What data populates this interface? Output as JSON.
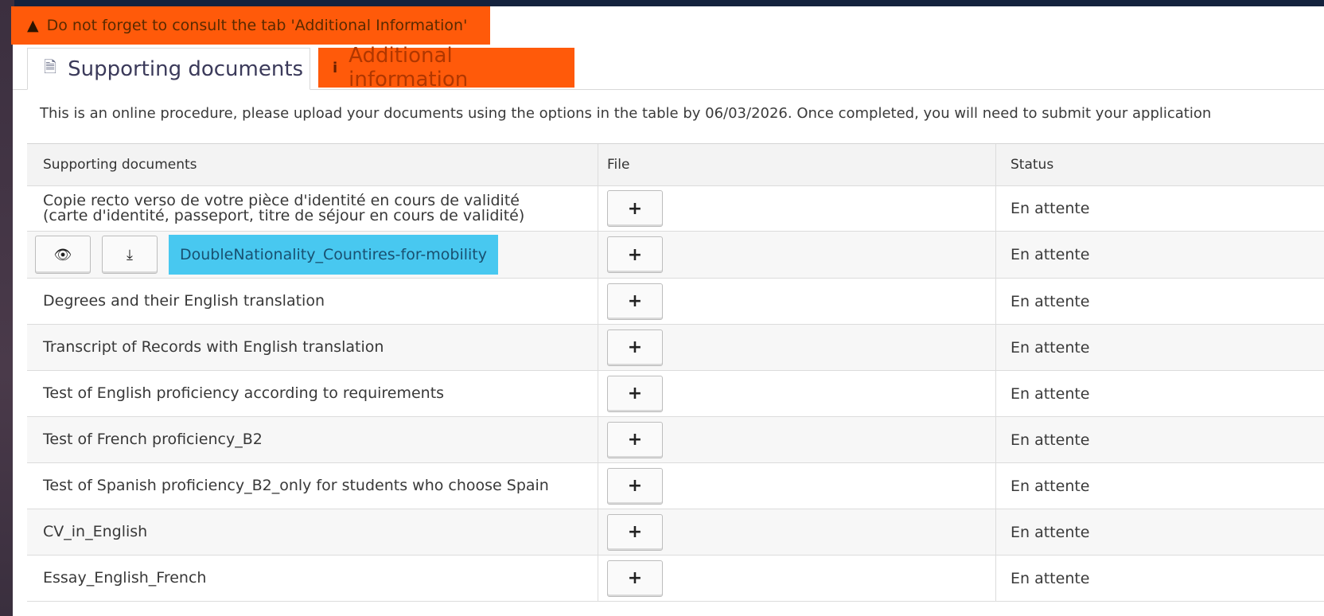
{
  "warning": {
    "icon": "warning-icon",
    "text": "Do not forget to consult the tab 'Additional Information'"
  },
  "tabs": [
    {
      "label": "Supporting documents",
      "icon": "document-icon",
      "active": true
    },
    {
      "label": "Additional information",
      "icon": "info-icon",
      "active": false
    }
  ],
  "info_text": "This is an online procedure, please upload your documents using the options in the table by 06/03/2026. Once completed, you will need to submit your application",
  "table": {
    "headers": [
      "Supporting documents",
      "File",
      "Status"
    ],
    "rows": [
      {
        "document": "Copie recto verso de votre pièce d'identité en cours de validité",
        "document_line2": "(carte d'identité, passeport, titre de séjour en cours de validité)",
        "file_button": "+",
        "status": "En attente"
      },
      {
        "file_name": "DoubleNationality_Countires-for-mobility",
        "view_icon": "eye-icon",
        "download_icon": "download-icon",
        "file_button": "+",
        "status": "En attente"
      },
      {
        "document": "Degrees and their English translation",
        "file_button": "+",
        "status": "En attente"
      },
      {
        "document": "Transcript of Records with English translation",
        "file_button": "+",
        "status": "En attente"
      },
      {
        "document": "Test of English proficiency according to requirements",
        "file_button": "+",
        "status": "En attente"
      },
      {
        "document": "Test of French proficiency_B2",
        "file_button": "+",
        "status": "En attente"
      },
      {
        "document": "Test of Spanish proficiency_B2_only for students who choose Spain",
        "file_button": "+",
        "status": "En attente"
      },
      {
        "document": "CV_in_English",
        "file_button": "+",
        "status": "En attente"
      },
      {
        "document": "Essay_English_French",
        "file_button": "+",
        "status": "En attente"
      }
    ]
  },
  "colors": {
    "warning_bg": "#ff5a0a",
    "file_chip_bg": "#48c8f0",
    "active_tab_text": "#3b3a5a"
  }
}
